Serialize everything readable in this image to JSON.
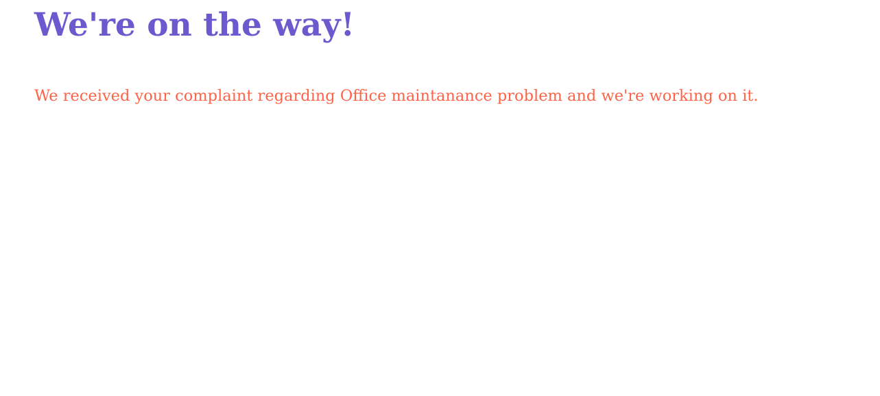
{
  "page": {
    "title": "We're on the way!",
    "message": "We received your complaint regarding Office maintanance problem and we're working on it."
  },
  "colors": {
    "title": "#6a5acd",
    "message": "#ff6347",
    "background": "#ffffff"
  }
}
